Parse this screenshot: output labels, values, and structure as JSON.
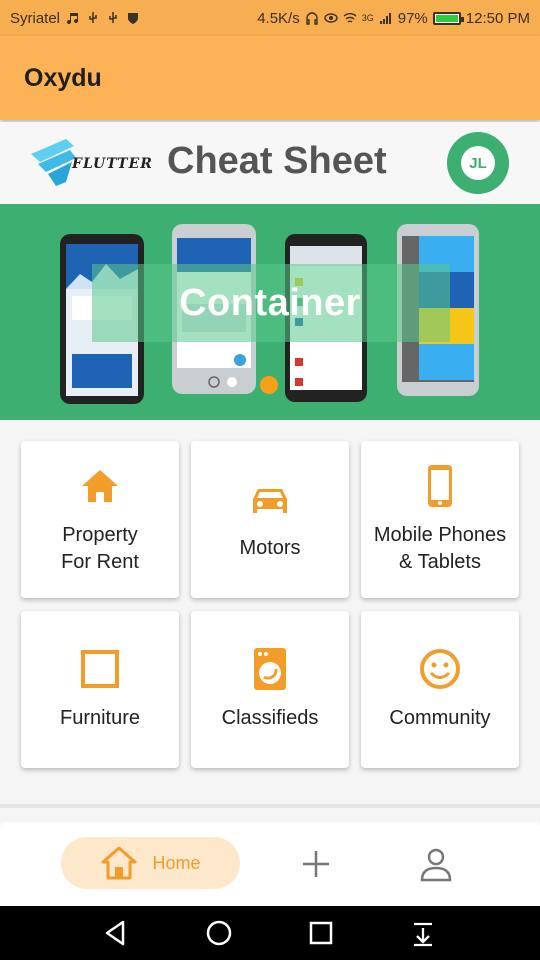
{
  "status_bar": {
    "carrier": "Syriatel",
    "speed": "4.5K/s",
    "network": "3G",
    "battery": "97%",
    "time": "12:50 PM"
  },
  "app_bar": {
    "title": "Oxydu"
  },
  "banner": {
    "logo_text": "FLUTTER",
    "title": "Cheat Sheet",
    "avatar_initials": "JL",
    "slide_label": "Container"
  },
  "categories": [
    {
      "label": "Property\nFor Rent",
      "icon": "home-icon"
    },
    {
      "label": "Motors",
      "icon": "car-icon"
    },
    {
      "label": "Mobile Phones\n& Tablets",
      "icon": "smartphone-icon"
    },
    {
      "label": "Furniture",
      "icon": "square-icon"
    },
    {
      "label": "Classifieds",
      "icon": "washing-machine-icon"
    },
    {
      "label": "Community",
      "icon": "smiley-icon"
    }
  ],
  "bottom_nav": {
    "home_label": "Home",
    "items": [
      "home-icon",
      "add-icon",
      "profile-icon"
    ]
  },
  "colors": {
    "accent": "#f29d2a",
    "app_bar": "#fdb355",
    "banner_green": "#3daf70"
  }
}
